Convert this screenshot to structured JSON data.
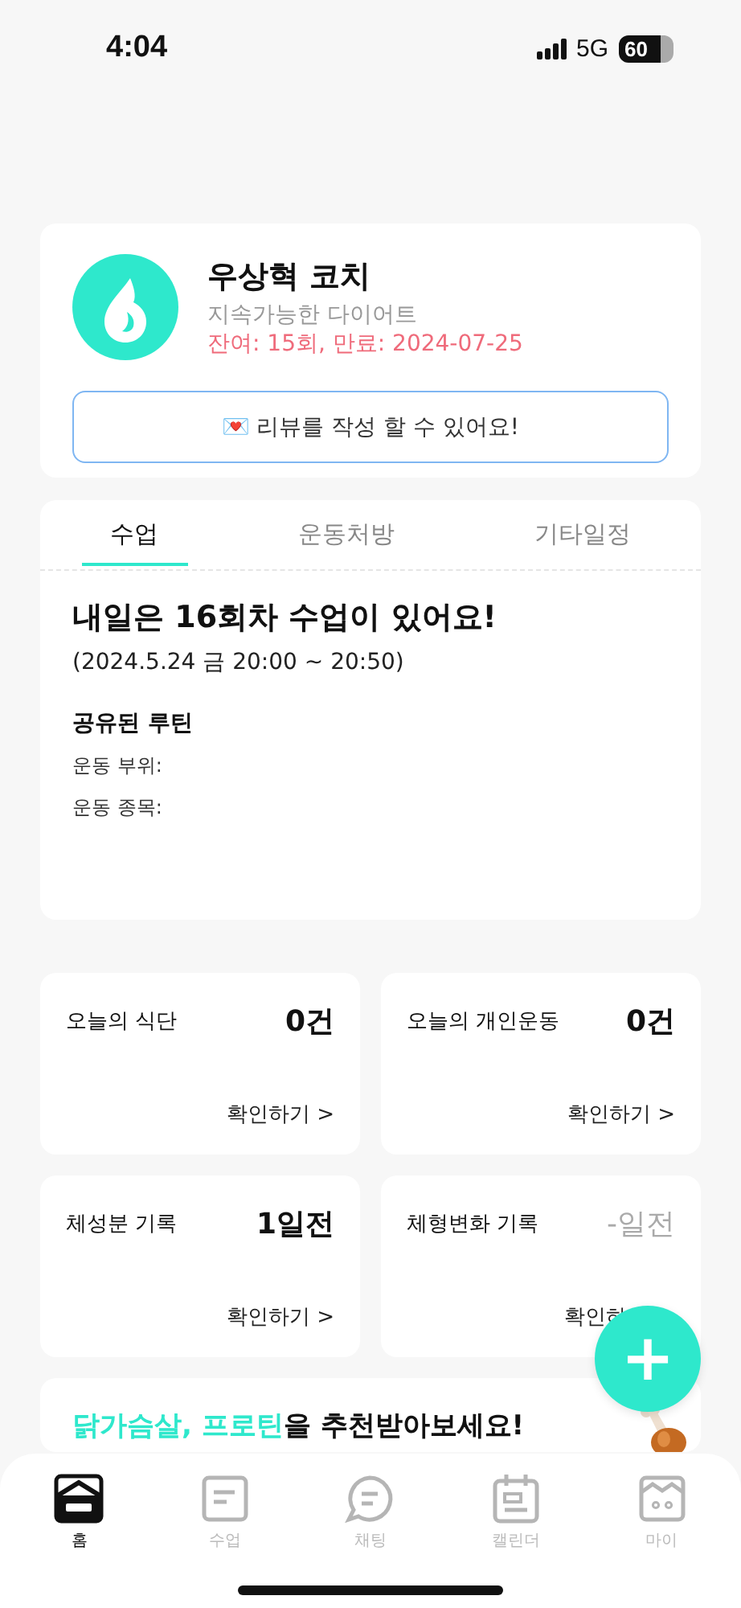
{
  "status_bar": {
    "time": "4:04",
    "network": "5G",
    "battery": "60"
  },
  "coach": {
    "name": "우상혁 코치",
    "program": "지속가능한 다이어트",
    "remaining": "잔여: 15회, 만료: 2024-07-25",
    "review_button": "💌 리뷰를 작성 할 수 있어요!"
  },
  "tabs": [
    {
      "label": "수업",
      "selected": true
    },
    {
      "label": "운동처방",
      "selected": false
    },
    {
      "label": "기타일정",
      "selected": false
    }
  ],
  "lesson": {
    "title": "내일은 16회차 수업이 있어요!",
    "time": "(2024.5.24 금 20:00 ~ 20:50)",
    "routine_title": "공유된 루틴",
    "fields": [
      "운동 부위:",
      "운동 종목:"
    ]
  },
  "summary_cards": [
    {
      "label": "오늘의 식단",
      "value": "0건",
      "muted": false,
      "link": "확인하기 >"
    },
    {
      "label": "오늘의 개인운동",
      "value": "0건",
      "muted": false,
      "link": "확인하기 >"
    },
    {
      "label": "체성분 기록",
      "value": "1일전",
      "muted": false,
      "link": "확인하기 >"
    },
    {
      "label": "체형변화 기록",
      "value": "-일전",
      "muted": true,
      "link": "확인하"
    }
  ],
  "fab": {
    "label": "+"
  },
  "banner": {
    "title_parts": [
      {
        "text": "닭가슴살, 프로틴",
        "highlight": true
      },
      {
        "text": "을 추천받아보세요!",
        "highlight": false
      }
    ]
  },
  "bottom_nav": [
    {
      "label": "홈",
      "kind": "home",
      "selected": true
    },
    {
      "label": "수업",
      "kind": "lesson",
      "selected": false
    },
    {
      "label": "채팅",
      "kind": "chat",
      "selected": false
    },
    {
      "label": "캘린더",
      "kind": "calendar",
      "selected": false
    },
    {
      "label": "마이",
      "kind": "my",
      "selected": false
    }
  ]
}
